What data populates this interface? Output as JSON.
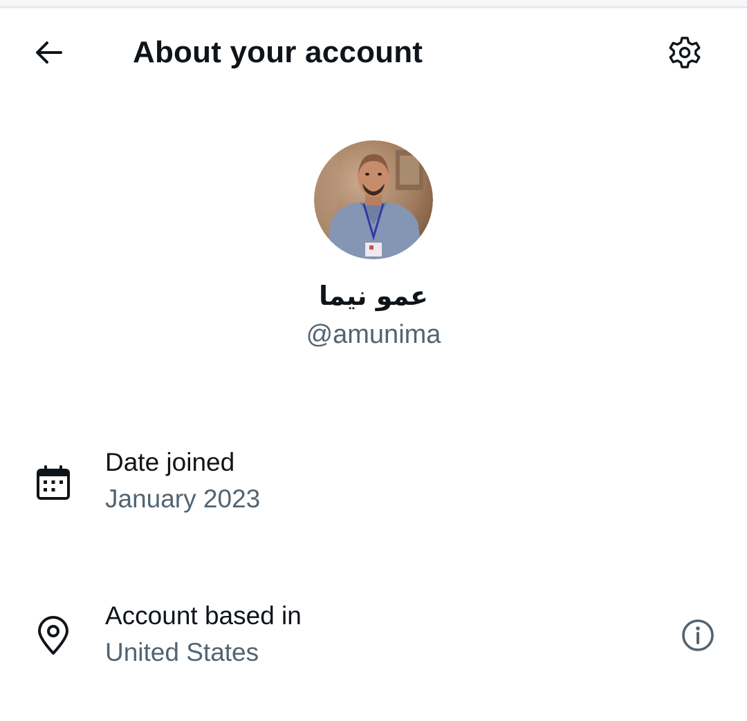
{
  "header": {
    "title": "About your account",
    "back_icon": "arrow-left-icon",
    "settings_icon": "gear-icon"
  },
  "profile": {
    "display_name": "عمو نيما",
    "handle": "@amunima",
    "avatar_icon": "profile-photo"
  },
  "details": [
    {
      "label": "Date joined",
      "value": "January 2023",
      "icon": "calendar-icon"
    },
    {
      "label": "Account based in",
      "value": "United States",
      "icon": "location-pin-icon",
      "info_icon": "info-icon"
    }
  ],
  "colors": {
    "text_primary": "#0f1419",
    "text_secondary": "#536471",
    "background": "#ffffff"
  }
}
